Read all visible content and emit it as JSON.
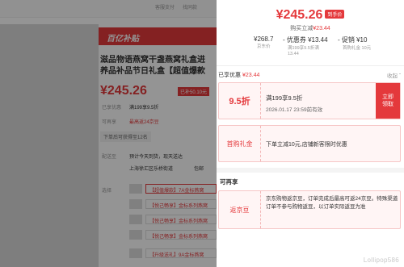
{
  "background": {
    "top_links": [
      "客服支付",
      "找同款"
    ],
    "banner": "百亿补贴",
    "title_line1": "滋品物语燕窝干盏燕窝礼盒进",
    "title_line2": "养品补品节日礼盒【超值爆款",
    "price": "¥245.26",
    "price_tag": "已补50.10元",
    "labels": {
      "promo": "已享优惠",
      "presale": "可再享",
      "delivery": "配送至",
      "options": "选择"
    },
    "promo_text": "满199享9.5折",
    "presale_text": "最高返24京豆",
    "gift": "下单后可获得至12名",
    "delivery_text": "预计今天到货，现天送达",
    "address": "上海徐汇区乐桥街道",
    "address_suffix": "包邮",
    "options": [
      "【超值爆款】7A金标燕窝",
      "【悦己畅享】金标系列燕窝",
      "【悦己畅享】金标系列燕窝",
      "【悦己畅享】金标系列燕窝",
      "【升级送礼】9A金标燕窝"
    ]
  },
  "panel": {
    "price": "¥245.26",
    "price_badge": "到手价",
    "buy_now_prefix": "购买立减",
    "buy_now_amount": "¥23.44",
    "calc": [
      {
        "main": "¥268.7",
        "sub": [
          "京东价"
        ]
      },
      {
        "main": "- 优惠券 ¥13.44",
        "sub": [
          "满199享9.5折满",
          "13.44"
        ]
      },
      {
        "main": "- 促销 ¥10",
        "sub": [
          "首购礼金 10元"
        ]
      }
    ],
    "enjoyed": {
      "label": "已享优惠",
      "amount": "¥23.44",
      "collapse": "收起"
    },
    "coupon": {
      "value": "9.5折",
      "title": "满199享9.5折",
      "validity": "2026.01.17 23:59前有效",
      "button": "立即领取"
    },
    "gift": {
      "name": "首购礼金",
      "desc": "下单立减10元,店铺新客限时优惠"
    },
    "more": {
      "title": "可再享",
      "name": "返京豆",
      "desc": "京东购物返京豆，订单完成后最高可返24京豆。特殊渠道订单不参与购物返豆，以订单实际返豆为准"
    },
    "watermark": "Lollipop586",
    "colors": {
      "accent": "#e4393c",
      "card_bg": "#fff5f5",
      "card_border": "#f6c6c6"
    }
  }
}
